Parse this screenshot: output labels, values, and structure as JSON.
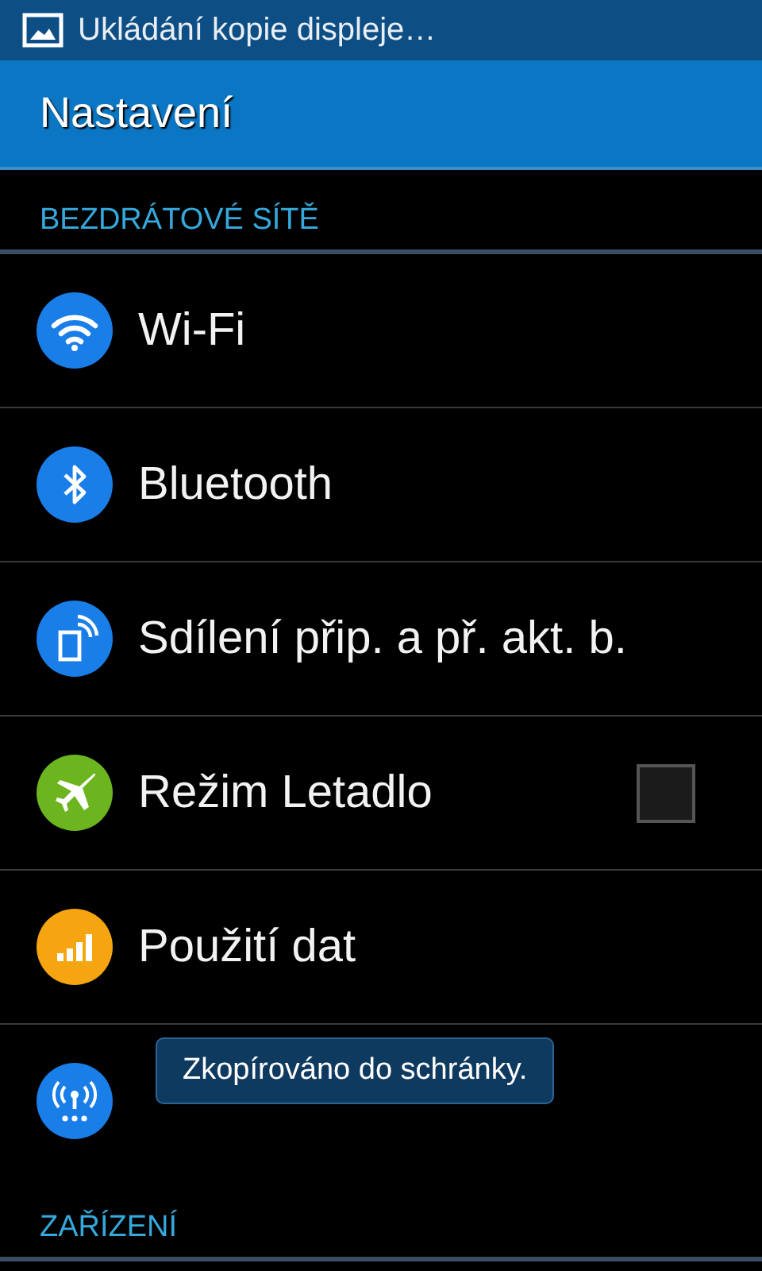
{
  "status_bar": {
    "notification": "Ukládání kopie displeje…"
  },
  "action_bar": {
    "title": "Nastavení"
  },
  "sections": [
    {
      "header": "BEZDRÁTOVÉ SÍTĚ",
      "items": [
        {
          "label": "Wi-Fi",
          "kind": "plain",
          "color": "#1a7ee8"
        },
        {
          "label": "Bluetooth",
          "kind": "plain",
          "color": "#1a7ee8"
        },
        {
          "label": "Sdílení přip. a př. akt. b.",
          "kind": "plain",
          "color": "#1a7ee8"
        },
        {
          "label": "Režim Letadlo",
          "kind": "checkbox",
          "checked": false,
          "color": "#6cb51f"
        },
        {
          "label": "Použití dat",
          "kind": "plain",
          "color": "#f5a50f"
        },
        {
          "kind": "plain",
          "color": "#1a7ee8"
        }
      ]
    },
    {
      "header": "ZAŘÍZENÍ"
    }
  ],
  "toast": {
    "text": "Zkopírováno do schránky."
  }
}
